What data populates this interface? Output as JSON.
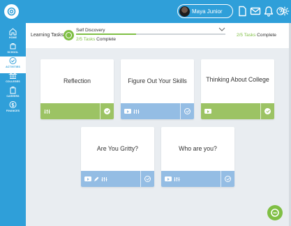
{
  "header": {
    "user_name": "Maya Junior"
  },
  "sidebar": {
    "items": [
      {
        "label": "HOME",
        "icon": "home-icon"
      },
      {
        "label": "SCHOOL",
        "icon": "school-icon"
      },
      {
        "label": "ACTIVITIES",
        "icon": "activities-icon",
        "active": true
      },
      {
        "label": "COLLEGES",
        "icon": "colleges-icon"
      },
      {
        "label": "CAREERS",
        "icon": "careers-icon"
      },
      {
        "label": "FINANCES",
        "icon": "finances-icon"
      }
    ]
  },
  "learning": {
    "label": "Learning Tasks",
    "task_title": "Self Discovery",
    "progress_count": "2/5 Tasks",
    "progress_complete": "Complete",
    "progress_fraction": 0.4
  },
  "cards": [
    {
      "title": "Reflection",
      "footer_color": "green",
      "icons": [
        "activity-icon"
      ],
      "completed": true
    },
    {
      "title": "Figure Out Your Skills",
      "footer_color": "blue",
      "icons": [
        "video-icon",
        "activity-icon"
      ],
      "completed": false
    },
    {
      "title": "Thinking About College",
      "footer_color": "green",
      "icons": [
        "video-icon"
      ],
      "completed": true
    },
    {
      "title": "Are You Gritty?",
      "footer_color": "blue",
      "icons": [
        "video-icon",
        "pencil-icon",
        "activity-icon"
      ],
      "completed": false
    },
    {
      "title": "Who are you?",
      "footer_color": "blue",
      "icons": [
        "video-icon",
        "activity-icon"
      ],
      "completed": false
    }
  ],
  "colors": {
    "brand_blue": "#2f9fd9",
    "accent_green": "#7fbf44",
    "footer_green": "#9cc364",
    "footer_blue": "#94bde4"
  }
}
